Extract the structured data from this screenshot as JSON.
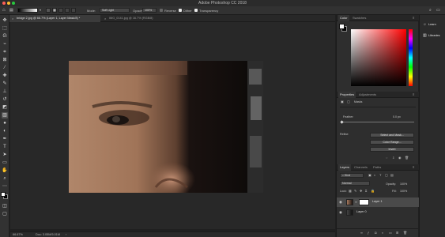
{
  "app": {
    "title": "Adobe Photoshop CC 2018"
  },
  "options_bar": {
    "mode_label": "Mode:",
    "mode_value": "Soft Light",
    "opacity_label": "Opacity:",
    "opacity_value": "100%",
    "reverse_label": "Reverse",
    "dither_label": "Dither",
    "transparency_label": "Transparency"
  },
  "tabs": [
    {
      "label": "bridge 2.jpg @ 66.7% (Layer 1, Layer Mask/8) *"
    },
    {
      "label": "IMG_0141.jpg @ 16.7% (RGB/8)"
    }
  ],
  "status": {
    "zoom": "66.67%",
    "doc": "Doc: 3.05M/5.01M"
  },
  "color_panel": {
    "tabs": [
      "Color",
      "Swatches"
    ]
  },
  "properties_panel": {
    "tabs": [
      "Properties",
      "Adjustments"
    ],
    "section_title": "Masks",
    "feather_label": "Feather:",
    "feather_value": "0.0 px",
    "refine_label": "Refine:",
    "select_mask_btn": "Select and Mask...",
    "color_range_btn": "Color Range...",
    "invert_btn": "Invert"
  },
  "layers_panel": {
    "tabs": [
      "Layers",
      "Channels",
      "Paths"
    ],
    "kind_value": "Kind",
    "blend_mode": "Normal",
    "opacity_label": "Opacity:",
    "opacity_value": "100%",
    "lock_label": "Lock:",
    "fill_label": "Fill:",
    "fill_value": "100%",
    "layers": [
      {
        "name": "Layer 1"
      },
      {
        "name": "Layer 0"
      }
    ]
  },
  "right_dock": {
    "items": [
      {
        "label": "Learn"
      },
      {
        "label": "Libraries"
      }
    ]
  },
  "colors": {
    "accent_blue": "#2f6fd6",
    "fg_color": "#ffffff",
    "bg_color": "#000000"
  }
}
